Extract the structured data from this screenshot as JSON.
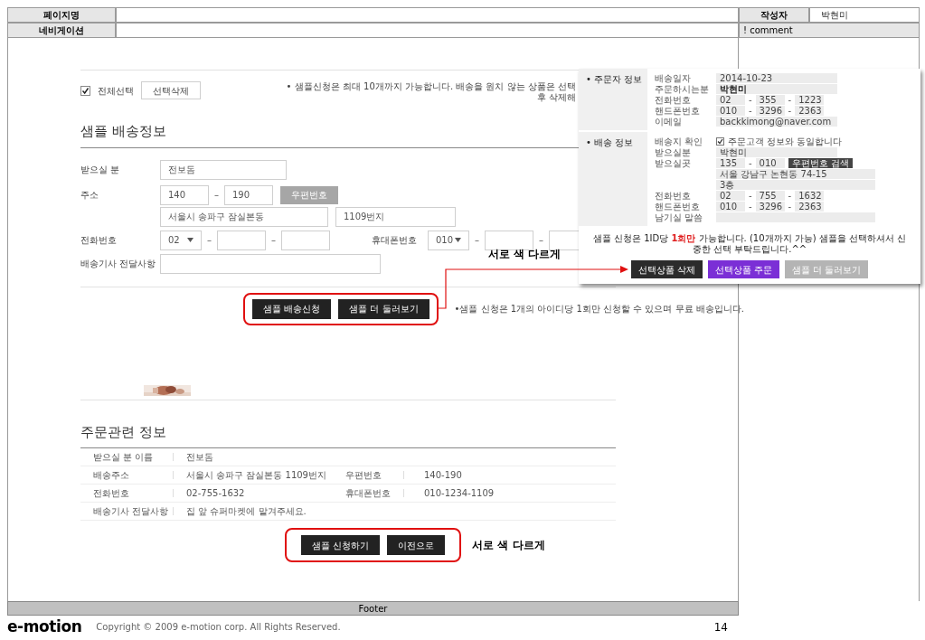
{
  "header": {
    "page_name_label": "페이지명",
    "navigation_label": "네비게이션",
    "author_label": "작성자",
    "author": "박현미",
    "comment": "! comment"
  },
  "mockup": {
    "select_all": {
      "label": "전체선택",
      "checked": true
    },
    "delete_button": "선택삭제",
    "limit_note": "• 샘플신청은 최대 10개까지 가능합니다. 배송을 원치 않는 상품은 선택 후 삭제해",
    "shipping_title": "샘플 배송정보",
    "separator": "–",
    "recipient": {
      "label": "받으실 분",
      "value": "전보돔"
    },
    "address": {
      "label": "주소",
      "zip1": "140",
      "zip2": "190",
      "zip_button": "우편번호",
      "line1": "서울시 송파구 잠실본동",
      "line2": "1109번지"
    },
    "phone": {
      "label": "전화번호",
      "prefix": "02"
    },
    "mobile": {
      "label": "휴대폰번호",
      "prefix": "010"
    },
    "message": {
      "label": "배송기사 전달사항"
    },
    "buttons": [
      "샘플 배송신청",
      "샘플 더 둘러보기"
    ],
    "free_note": "•샘플 신청은 1개의 아이디당 1회만 신청할 수 있으며 무료 배송입니다.",
    "order_title": "주문관련 정보",
    "order_rows": [
      {
        "label": "받으실 분 이름",
        "value": "전보돔"
      },
      {
        "label": "배송주소",
        "value": "서울시 송파구 잠실본동 1109번지",
        "label2": "우편번호",
        "value2": "140-190"
      },
      {
        "label": "전화번호",
        "value": "02-755-1632",
        "label2": "휴대폰번호",
        "value2": "010-1234-1109"
      },
      {
        "label": "배송기사 전달사항",
        "value": "집 앞 슈퍼마켓에 맡겨주세요."
      }
    ],
    "order_buttons": [
      "샘플 신청하기",
      "이전으로"
    ]
  },
  "popup": {
    "separator": "-",
    "sections": [
      {
        "title": "• 주문자 정보",
        "rows": [
          {
            "kind": "field",
            "label": "배송일자",
            "value": "2014-10-23",
            "bold": false
          },
          {
            "kind": "field",
            "label": "주문하시는분",
            "value": "박현미",
            "bold": true
          },
          {
            "kind": "parts",
            "label": "전화번호",
            "parts": [
              "02",
              "355",
              "1223"
            ]
          },
          {
            "kind": "parts",
            "label": "핸드폰번호",
            "parts": [
              "010",
              "3296",
              "2363"
            ]
          },
          {
            "kind": "field",
            "label": "이메일",
            "value": "backkimong@naver.com",
            "bold": false
          }
        ]
      },
      {
        "title": "• 배송 정보",
        "rows": [
          {
            "kind": "check",
            "label": "배송지 확인",
            "checked": true,
            "text": "주문고객 정보와 동일합니다"
          },
          {
            "kind": "field",
            "label": "받으실분",
            "value": "박현미",
            "bold": false
          },
          {
            "kind": "zip",
            "label": "받으실곳",
            "parts": [
              "135",
              "010"
            ],
            "button": "우편번호 검색"
          },
          {
            "kind": "line",
            "value": "서울 강남구 논현동 74-15"
          },
          {
            "kind": "line",
            "value": "3층"
          },
          {
            "kind": "parts",
            "label": "전화번호",
            "parts": [
              "02",
              "755",
              "1632"
            ]
          },
          {
            "kind": "parts",
            "label": "핸드폰번호",
            "parts": [
              "010",
              "3296",
              "2363"
            ]
          },
          {
            "kind": "line",
            "label": "남기실 말씀"
          }
        ]
      }
    ],
    "note": {
      "before": "샘플 신청은 1ID당 ",
      "highlight": "1회만",
      "after": " 가능합니다. (10개까지 가능) 샘플을 선택하셔서 신중한 선택 부탁드립니다.^^"
    },
    "buttons": [
      {
        "label": "선택상품 삭제",
        "color": "#2b2b2b"
      },
      {
        "label": "선택상품 주문",
        "color": "#7b2fd6"
      },
      {
        "label": "샘플 더 둘러보기",
        "color": "#b4b4b4"
      }
    ]
  },
  "annotations": [
    "서로 색 다르게",
    "서로 색 다르게"
  ],
  "footer": {
    "label": "Footer",
    "logo": "e-motion",
    "copyright": "Copyright © 2009 e-motion corp. All Rights Reserved.",
    "page": "14"
  }
}
